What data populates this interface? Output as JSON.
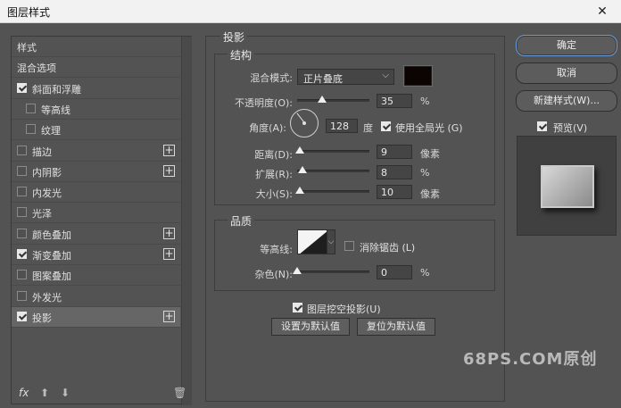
{
  "window": {
    "title": "图层样式",
    "close_label": "✕"
  },
  "left_list": {
    "items": [
      {
        "label": "样式",
        "checkbox": false,
        "checked": false,
        "plus": false,
        "indent": 0,
        "selected": false
      },
      {
        "label": "混合选项",
        "checkbox": false,
        "checked": false,
        "plus": false,
        "indent": 0,
        "selected": false
      },
      {
        "label": "斜面和浮雕",
        "checkbox": true,
        "checked": true,
        "plus": false,
        "indent": 0,
        "selected": false
      },
      {
        "label": "等高线",
        "checkbox": true,
        "checked": false,
        "plus": false,
        "indent": 1,
        "selected": false
      },
      {
        "label": "纹理",
        "checkbox": true,
        "checked": false,
        "plus": false,
        "indent": 1,
        "selected": false
      },
      {
        "label": "描边",
        "checkbox": true,
        "checked": false,
        "plus": true,
        "indent": 0,
        "selected": false
      },
      {
        "label": "内阴影",
        "checkbox": true,
        "checked": false,
        "plus": true,
        "indent": 0,
        "selected": false
      },
      {
        "label": "内发光",
        "checkbox": true,
        "checked": false,
        "plus": false,
        "indent": 0,
        "selected": false
      },
      {
        "label": "光泽",
        "checkbox": true,
        "checked": false,
        "plus": false,
        "indent": 0,
        "selected": false
      },
      {
        "label": "颜色叠加",
        "checkbox": true,
        "checked": false,
        "plus": true,
        "indent": 0,
        "selected": false
      },
      {
        "label": "渐变叠加",
        "checkbox": true,
        "checked": true,
        "plus": true,
        "indent": 0,
        "selected": false
      },
      {
        "label": "图案叠加",
        "checkbox": true,
        "checked": false,
        "plus": false,
        "indent": 0,
        "selected": false
      },
      {
        "label": "外发光",
        "checkbox": true,
        "checked": false,
        "plus": false,
        "indent": 0,
        "selected": false
      },
      {
        "label": "投影",
        "checkbox": true,
        "checked": true,
        "plus": true,
        "indent": 0,
        "selected": true
      }
    ],
    "plus_label": "+",
    "tools": {
      "fx": "fx",
      "up": "⬆",
      "down": "⬇",
      "trash": "🗑"
    }
  },
  "shadow": {
    "section_title": "投影",
    "structure_title": "结构",
    "blend_mode_label": "混合模式:",
    "blend_mode_value": "正片叠底",
    "shadow_color": "#0c0303",
    "opacity_label": "不透明度(O):",
    "opacity_value": "35",
    "opacity_unit": "%",
    "opacity_fraction": 0.35,
    "angle_label": "角度(A):",
    "angle_value": "128",
    "angle_unit": "度",
    "global_light_label": "使用全局光 (G)",
    "global_light_checked": true,
    "distance_label": "距离(D):",
    "distance_value": "9",
    "distance_unit": "像素",
    "distance_fraction": 0.04,
    "spread_label": "扩展(R):",
    "spread_value": "8",
    "spread_unit": "%",
    "spread_fraction": 0.08,
    "size_label": "大小(S):",
    "size_value": "10",
    "size_unit": "像素",
    "size_fraction": 0.04,
    "quality_title": "品质",
    "contour_label": "等高线:",
    "antialias_label": "消除锯齿 (L)",
    "antialias_checked": false,
    "noise_label": "杂色(N):",
    "noise_value": "0",
    "noise_unit": "%",
    "noise_fraction": 0.0,
    "knockout_label": "图层挖空投影(U)",
    "knockout_checked": true,
    "set_default_label": "设置为默认值",
    "reset_default_label": "复位为默认值"
  },
  "right": {
    "ok_label": "确定",
    "cancel_label": "取消",
    "new_style_label": "新建样式(W)...",
    "preview_label": "预览(V)",
    "preview_checked": true
  },
  "watermark": "68PS.COM原创"
}
